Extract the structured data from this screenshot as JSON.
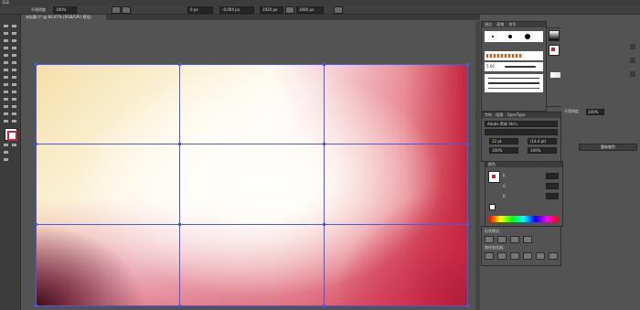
{
  "menubar": {
    "label": "浮动"
  },
  "control_bar": {
    "opacity_label": "不透明度",
    "opacity_value": "100%",
    "x_value": "0 px",
    "y_value": "-0.004 px",
    "w_value": "1920 px",
    "h_value": "1080 px"
  },
  "document_tab": {
    "title": "未标题-1* @ 66.67% (RGB/GPU 预览)"
  },
  "brushes_panel": {
    "tabs": [
      "描边",
      "画笔",
      "符号"
    ],
    "brush_size": "5.00"
  },
  "color_picker_panel": {
    "header": "颜色",
    "opacity_label": "不透明度",
    "opacity_value": "100%",
    "button_label": "重新着色"
  },
  "character_panel": {
    "tabs": [
      "字符",
      "段落",
      "OpenType"
    ],
    "font_name": "Adobe 黑体 Std L",
    "font_size": "12 pt",
    "leading": "(14.4 pt)",
    "scale_h": "100%",
    "scale_v": "100%"
  },
  "color_panel": {
    "tab": "颜色",
    "channels": [
      "R",
      "G",
      "B"
    ]
  },
  "pathfinder_panel": {
    "shape_modes_label": "形状模式：",
    "pathfinder_label": "路径查找器："
  },
  "colors": {
    "accent_guide": "#4a58e8",
    "ui_dark": "#3c3c3c",
    "ui_mid": "#535353"
  }
}
